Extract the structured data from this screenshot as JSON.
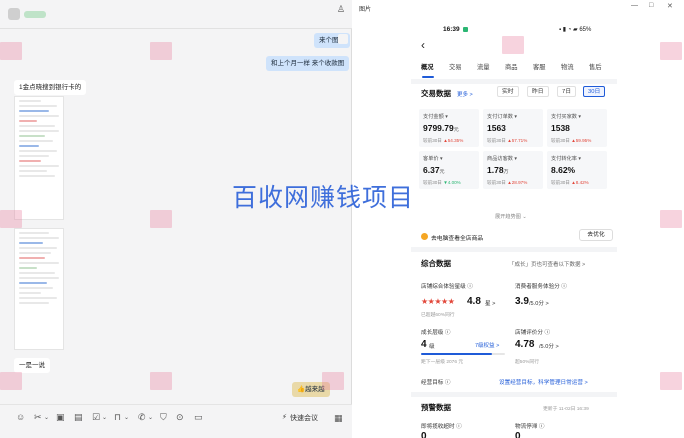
{
  "chat": {
    "messages": [
      {
        "text": "来个图图",
        "side": "out"
      },
      {
        "text": "和上个月一样 来个收款图",
        "side": "out"
      },
      {
        "text": "1金点晓搜到银行卡的",
        "side": "in"
      },
      {
        "text": "一是一说",
        "side": "in"
      },
      {
        "text": "👍越来越",
        "side": "out"
      }
    ],
    "toolbar": {
      "quick_meeting": "快速会议"
    }
  },
  "viewer": {
    "title": "图片",
    "window_controls": [
      "—",
      "□",
      "✕"
    ]
  },
  "phone": {
    "status_time": "16:39",
    "status_right": "▪ ▮ ◔ ▰ 65%",
    "tabs": [
      "概况",
      "交易",
      "流量",
      "商品",
      "客服",
      "物流",
      "售后"
    ],
    "trade": {
      "title": "交易数据",
      "more": "更多 >",
      "ranges": [
        "实时",
        "昨日",
        "7日",
        "30日"
      ],
      "active_range": "30日",
      "cards": [
        {
          "label": "支付金额 ▾",
          "value": "9799.79",
          "unit": "元",
          "cmp": "较前30日",
          "delta": "▲54.35%",
          "dir": "up"
        },
        {
          "label": "支付订单数 ▾",
          "value": "1563",
          "unit": "",
          "cmp": "较前30日",
          "delta": "▲57.71%",
          "dir": "up"
        },
        {
          "label": "支付买家数 ▾",
          "value": "1538",
          "unit": "",
          "cmp": "较前30日",
          "delta": "▲59.95%",
          "dir": "up"
        },
        {
          "label": "客单价 ▾",
          "value": "6.37",
          "unit": "元",
          "cmp": "较前30日",
          "delta": "▼4.00%",
          "dir": "dn"
        },
        {
          "label": "商品访客数 ▾",
          "value": "1.78",
          "unit": "万",
          "cmp": "较前30日",
          "delta": "▲28.97%",
          "dir": "up"
        },
        {
          "label": "支付转化率 ▾",
          "value": "8.62%",
          "unit": "",
          "cmp": "较前30日",
          "delta": "▲8.42%",
          "dir": "up"
        }
      ],
      "expand": "展开趋势图 ⌄",
      "hint": "去电脑查看全店商品",
      "hint_button": "去优化"
    },
    "summary": {
      "title": "综合数据",
      "link": "「成长」页也可查看以下数据 >",
      "store_rating_label": "店铺综合体验星级 ⓘ",
      "store_rating": "4.8",
      "store_rating_unit": "星 >",
      "store_rating_sub": "已超越60%同行",
      "stars": "★★★★★",
      "service_label": "消费者服务体验分 ⓘ",
      "service_score": "3.9",
      "service_unit": "/5.0分 >",
      "level_label": "成长层级 ⓘ",
      "level_value": "4",
      "level_unit": "级",
      "level_link": "7级权益 >",
      "level_progress": 0.84,
      "level_sub": "距下一层级 2076 元",
      "review_label": "店铺评价分 ⓘ",
      "review_score": "4.78",
      "review_unit": "/5.0分 >",
      "review_sub": "超50%同行",
      "goal_label": "经营目标 ⓘ",
      "goal_link": "设置经营目标，科学管理日常运营 >"
    },
    "alerts": {
      "title": "预警数据",
      "update": "更新于 11-02日 16:39",
      "items": [
        {
          "label": "即将揽收超时 ⓘ",
          "value": "0"
        },
        {
          "label": "物流停滞 ⓘ",
          "value": "0"
        }
      ]
    }
  },
  "watermark_center": "百收网赚钱项目",
  "colors": {
    "accent": "#1f5bd8",
    "up": "#e2473a",
    "down": "#2bb673",
    "watermark": "#2f63d9"
  }
}
